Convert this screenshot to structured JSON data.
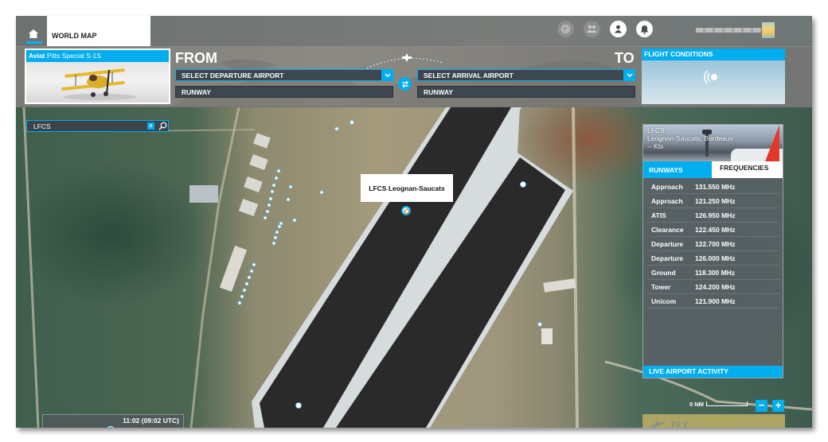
{
  "topbar": {
    "home_label": "Home",
    "active_tab": "WORLD MAP",
    "icons": [
      "activity-icon",
      "multiplayer-icon",
      "profile-icon",
      "notifications-icon"
    ]
  },
  "aircraft": {
    "brand": "Aviat",
    "model": "Pitts Special S-1S"
  },
  "route": {
    "from_label": "FROM",
    "to_label": "TO",
    "departure_placeholder": "SELECT DEPARTURE AIRPORT",
    "arrival_placeholder": "SELECT ARRIVAL AIRPORT",
    "departure_runway": "RUNWAY",
    "arrival_runway": "RUNWAY"
  },
  "flight_conditions": {
    "title": "FLIGHT CONDITIONS"
  },
  "search": {
    "value": "LFCS",
    "clear_label": "x"
  },
  "map": {
    "airport_label": "LFCS Leognan-Saucats"
  },
  "time": {
    "label": "11:02 (09:02 UTC)",
    "progress": 0.48
  },
  "airport_panel": {
    "icao": "LFCS",
    "name": "Leognan-Saucats, Bordeaux",
    "wind": "-- Kts",
    "tabs": [
      "RUNWAYS",
      "FREQUENCIES"
    ],
    "active_tab": "FREQUENCIES",
    "frequencies": [
      {
        "name": "Approach",
        "value": "131.550 MHz"
      },
      {
        "name": "Approach",
        "value": "121.250 MHz"
      },
      {
        "name": "ATIS",
        "value": "126.950 MHz"
      },
      {
        "name": "Clearance",
        "value": "122.450 MHz"
      },
      {
        "name": "Departure",
        "value": "122.700 MHz"
      },
      {
        "name": "Departure",
        "value": "126.000 MHz"
      },
      {
        "name": "Ground",
        "value": "118.300 MHz"
      },
      {
        "name": "Tower",
        "value": "124.200 MHz"
      },
      {
        "name": "Unicom",
        "value": "121.900 MHz"
      }
    ],
    "live_activity_label": "LIVE AIRPORT ACTIVITY"
  },
  "scale": {
    "label": "0 NM",
    "zoom_out": "−",
    "zoom_in": "+"
  },
  "fly_button": {
    "label": "FLY"
  },
  "colors": {
    "accent": "#00aef0",
    "field_bg": "#3e4650",
    "fly_bg": "#b4aa64"
  }
}
